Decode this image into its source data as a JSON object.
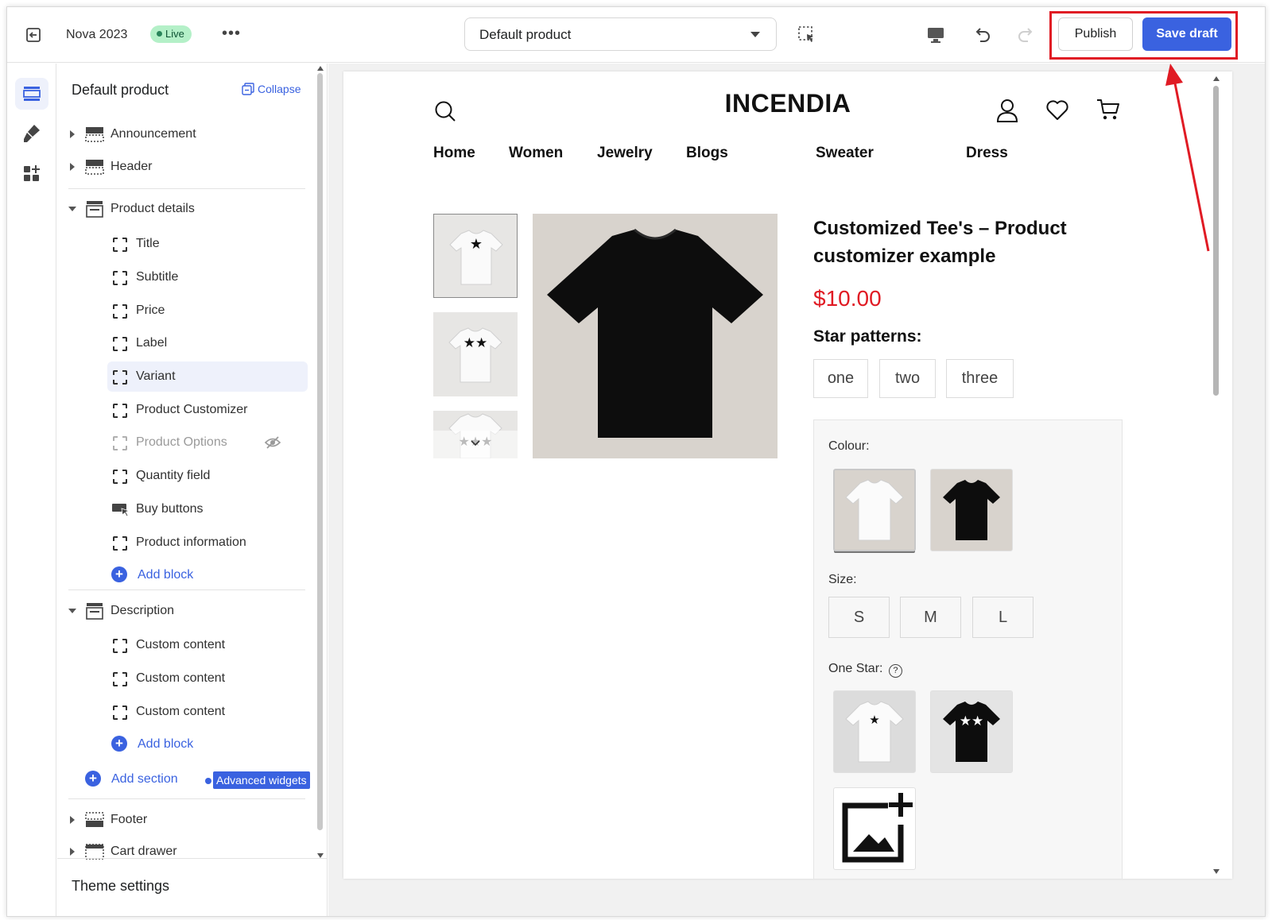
{
  "topbar": {
    "theme_name": "Nova 2023",
    "live_badge": "Live",
    "more": "•••",
    "template_select": "Default product",
    "publish_label": "Publish",
    "save_label": "Save draft"
  },
  "sidebar": {
    "title": "Default product",
    "collapse": "Collapse",
    "sections_top": [
      "Announcement",
      "Header"
    ],
    "product_details": {
      "label": "Product details",
      "blocks": [
        "Title",
        "Subtitle",
        "Price",
        "Label",
        "Variant",
        "Product Customizer",
        "Product Options",
        "Quantity field",
        "Buy buttons",
        "Product information"
      ],
      "selected_block": "Variant",
      "hidden_block": "Product Options",
      "add_block": "Add block"
    },
    "description": {
      "label": "Description",
      "blocks": [
        "Custom content",
        "Custom content",
        "Custom content"
      ],
      "add_block": "Add block"
    },
    "add_section": "Add section",
    "advanced_widgets": "Advanced widgets",
    "sections_bottom": [
      "Footer",
      "Cart drawer"
    ],
    "theme_settings": "Theme settings"
  },
  "preview": {
    "store_name": "INCENDIA",
    "nav": [
      "Home",
      "Women",
      "Jewelry",
      "Blogs",
      "Sweater",
      "Dress"
    ],
    "product_title": "Customized Tee's – Product customizer example",
    "price": "$10.00",
    "star_patterns_label": "Star patterns:",
    "star_patterns": [
      "one",
      "two",
      "three"
    ],
    "colour_label": "Colour:",
    "size_label": "Size:",
    "sizes": [
      "S",
      "M",
      "L"
    ],
    "one_star_label": "One Star:",
    "help_mark": "?"
  },
  "colors": {
    "accent": "#3a62e0",
    "price": "#e01b24",
    "annotation": "#e01b24",
    "live_bg": "#b4f0c8"
  }
}
